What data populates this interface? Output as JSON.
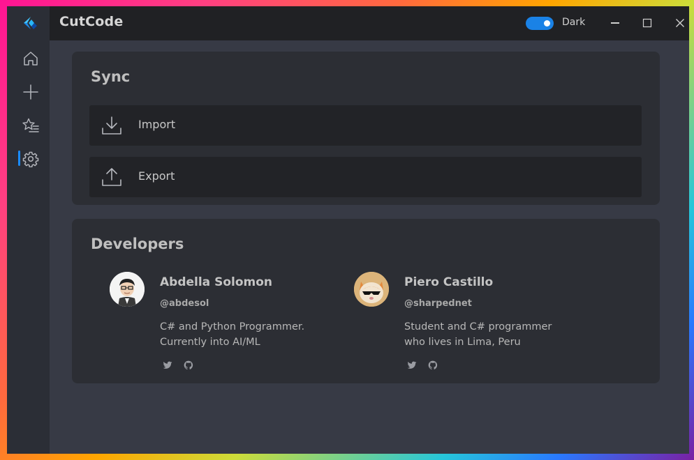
{
  "app": {
    "title": "CutCode"
  },
  "theme_toggle": {
    "label": "Dark",
    "state": "on",
    "accent": "#1a82e6"
  },
  "window_controls": [
    "minimize-icon",
    "maximize-icon",
    "close-icon"
  ],
  "sidebar": {
    "items": [
      {
        "name": "home",
        "icon": "home-icon"
      },
      {
        "name": "add",
        "icon": "plus-icon"
      },
      {
        "name": "favorites",
        "icon": "star-list-icon"
      },
      {
        "name": "settings",
        "icon": "gear-icon",
        "active": true
      }
    ]
  },
  "sync": {
    "title": "Sync",
    "import_label": "Import",
    "export_label": "Export"
  },
  "developers": {
    "title": "Developers",
    "people": [
      {
        "name": "Abdella Solomon",
        "handle": "@abdesol",
        "bio_line1": "C# and Python Programmer.",
        "bio_line2": "Currently into AI/ML",
        "links": [
          "twitter-icon",
          "github-icon"
        ]
      },
      {
        "name": "Piero Castillo",
        "handle": "@sharpednet",
        "bio_line1": "Student and C# programmer",
        "bio_line2": "who lives in Lima, Peru",
        "links": [
          "twitter-icon",
          "github-icon"
        ]
      }
    ]
  }
}
